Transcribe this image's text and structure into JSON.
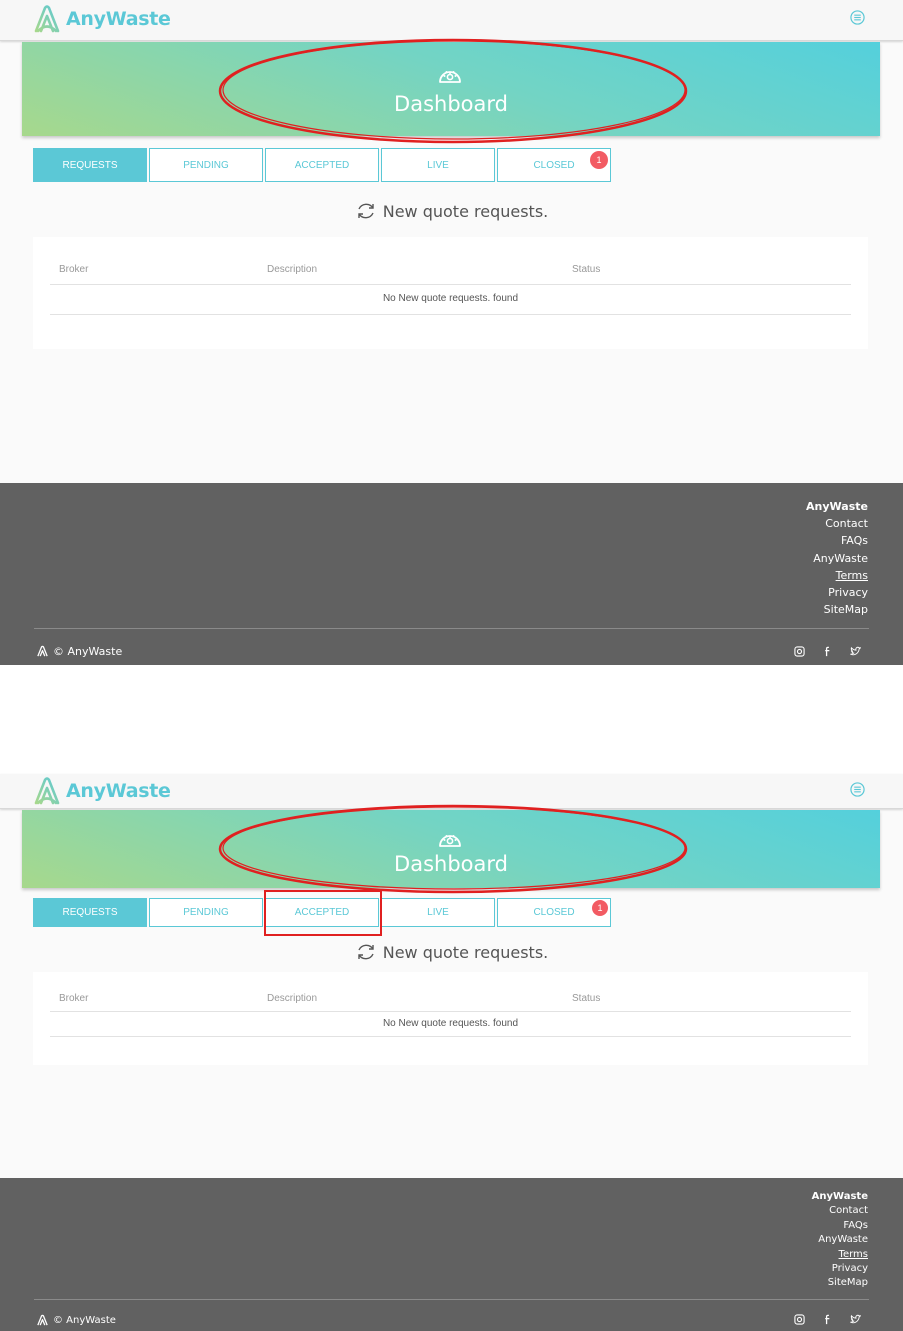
{
  "app": {
    "name": "AnyWaste",
    "brand_color": "#5bc8d6",
    "badge_color": "#f25b63",
    "annotation_color": "#e02020"
  },
  "hero": {
    "title": "Dashboard",
    "icon": "speedometer-icon"
  },
  "tabs": [
    {
      "label": "REQUESTS",
      "active": true
    },
    {
      "label": "PENDING",
      "active": false
    },
    {
      "label": "ACCEPTED",
      "active": false
    },
    {
      "label": "LIVE",
      "active": false
    },
    {
      "label": "CLOSED",
      "active": false,
      "badge": "1"
    }
  ],
  "section": {
    "title": "New quote requests.",
    "icon": "refresh-icon"
  },
  "table": {
    "columns": [
      "Broker",
      "Description",
      "Status"
    ],
    "empty_message": "No New quote requests. found"
  },
  "footer": {
    "links": [
      "AnyWaste",
      "Contact",
      "FAQs",
      "AnyWaste",
      "Terms",
      "Privacy",
      "SiteMap"
    ],
    "copyright": "© AnyWaste",
    "social_icons": [
      "instagram-icon",
      "facebook-icon",
      "twitter-icon"
    ]
  }
}
